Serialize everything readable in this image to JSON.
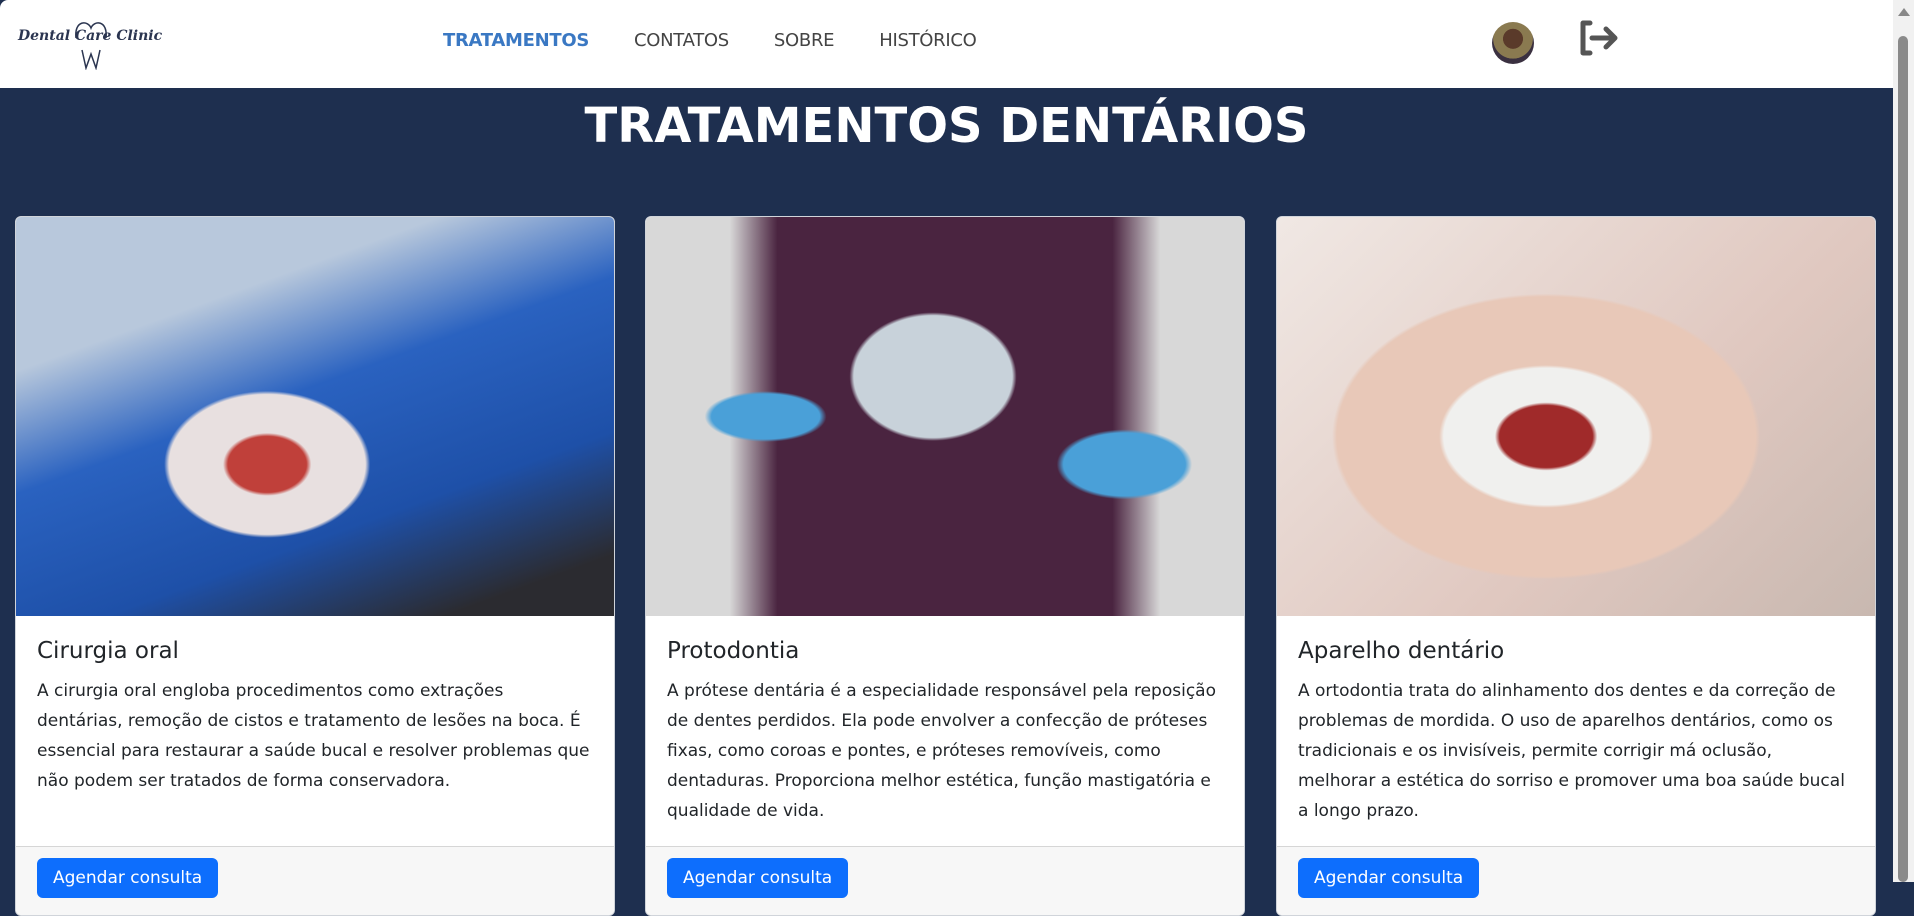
{
  "brand": {
    "logo_text": "Dental Care Clinic"
  },
  "nav": {
    "items": [
      {
        "label": "TRATAMENTOS",
        "active": true
      },
      {
        "label": "CONTATOS"
      },
      {
        "label": "SOBRE"
      },
      {
        "label": "HISTÓRICO"
      }
    ]
  },
  "page": {
    "title": "TRATAMENTOS DENTÁRIOS"
  },
  "cards": [
    {
      "title": "Cirurgia oral",
      "text": "A cirurgia oral engloba procedimentos como extrações dentárias, remoção de cistos e tratamento de lesões na boca. É essencial para restaurar a saúde bucal e resolver problemas que não podem ser tratados de forma conservadora.",
      "button": "Agendar consulta"
    },
    {
      "title": "Protodontia",
      "text": "A prótese dentária é a especialidade responsável pela reposição de dentes perdidos. Ela pode envolver a confecção de próteses fixas, como coroas e pontes, e próteses removíveis, como dentaduras. Proporciona melhor estética, função mastigatória e qualidade de vida.",
      "button": "Agendar consulta"
    },
    {
      "title": "Aparelho dentário",
      "text": "A ortodontia trata do alinhamento dos dentes e da correção de problemas de mordida. O uso de aparelhos dentários, como os tradicionais e os invisíveis, permite corrigir má oclusão, melhorar a estética do sorriso e promover uma boa saúde bucal a longo prazo.",
      "button": "Agendar consulta"
    }
  ],
  "colors": {
    "accent": "#3a78c3",
    "background": "#1e2f4f",
    "button": "#0d6efd"
  }
}
